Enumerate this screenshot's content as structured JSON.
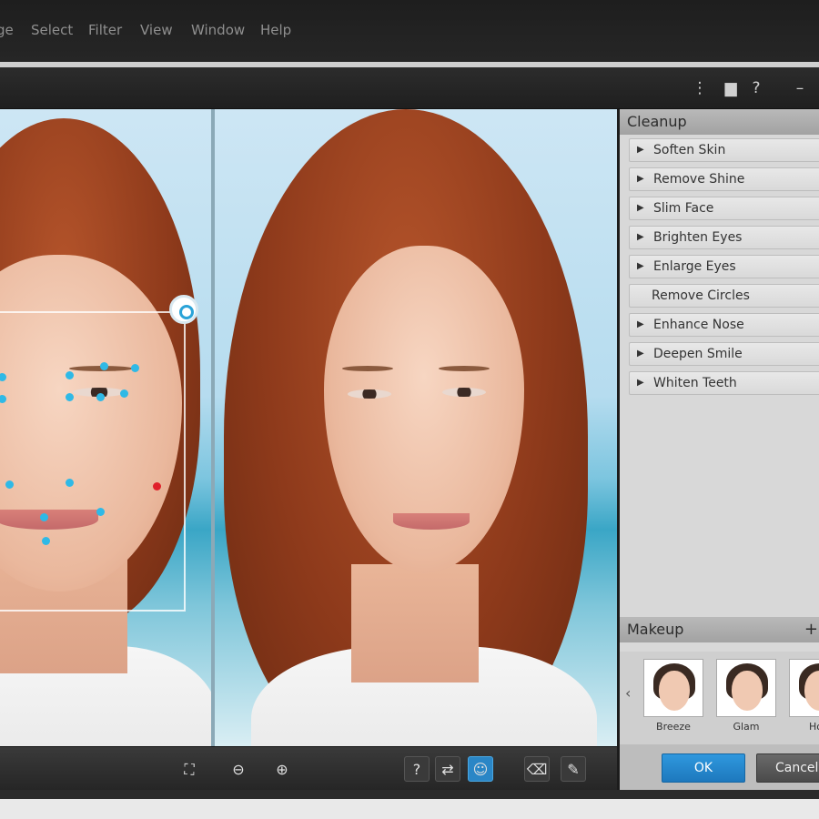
{
  "menu": [
    "ge",
    "Select",
    "Filter",
    "View",
    "Window",
    "Help"
  ],
  "titlebar": {
    "icons": [
      "panel-icon",
      "chat-icon",
      "help-icon",
      "minimize-icon"
    ],
    "glyphs": [
      "⋮",
      "▆",
      "?",
      "–"
    ]
  },
  "canvas_toolbar": {
    "fit": "⛶",
    "zoom_out": "⊖",
    "zoom_in": "⊕",
    "help": "?",
    "compare": "⇄",
    "face_detect": "☺",
    "eraser": "⌫",
    "brush": "✎"
  },
  "cleanup": {
    "title": "Cleanup",
    "items": [
      {
        "label": "Soften Skin",
        "arrow": "▶"
      },
      {
        "label": "Remove Shine",
        "arrow": "▶"
      },
      {
        "label": "Slim Face",
        "arrow": "▶"
      },
      {
        "label": "Brighten Eyes",
        "arrow": "▶"
      },
      {
        "label": "Enlarge Eyes",
        "arrow": "▶"
      },
      {
        "label": "Remove Circles",
        "arrow": ""
      },
      {
        "label": "Enhance Nose",
        "arrow": "▶"
      },
      {
        "label": "Deepen Smile",
        "arrow": "▶"
      },
      {
        "label": "Whiten Teeth",
        "arrow": "▶"
      }
    ]
  },
  "makeup": {
    "title": "Makeup",
    "plus": "+",
    "prev_arrow": "‹",
    "presets": [
      "Breeze",
      "Glam",
      "Hon"
    ]
  },
  "footer": {
    "ok": "OK",
    "cancel": "Cancel"
  },
  "colors": {
    "accent": "#2a86c6",
    "landmark": "#2fb9e6",
    "landmark_alert": "#e0202a"
  }
}
